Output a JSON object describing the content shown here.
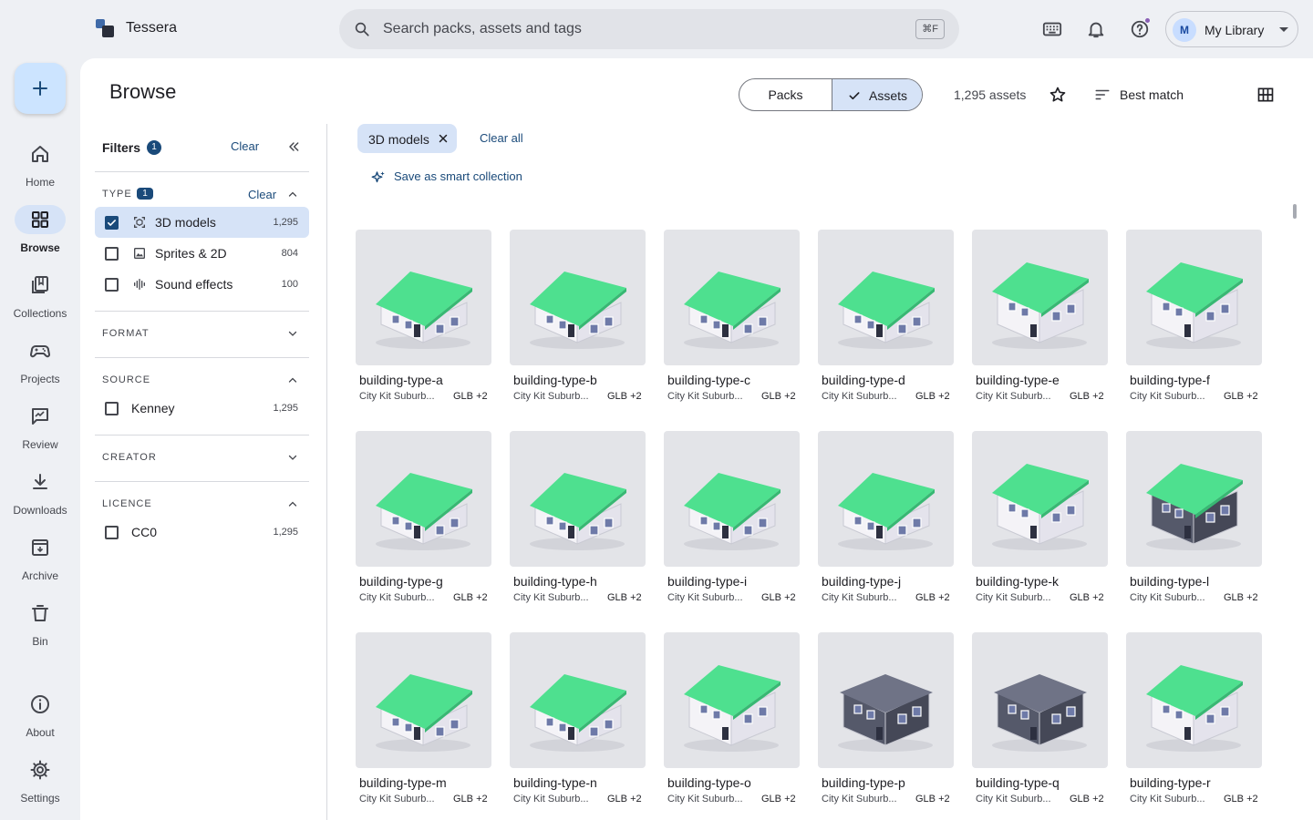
{
  "app": {
    "name": "Tessera"
  },
  "search": {
    "placeholder": "Search packs, assets and tags",
    "shortcut": "⌘F"
  },
  "topbar": {
    "icons": [
      "keyboard-icon",
      "bell-icon",
      "help-icon"
    ],
    "library_avatar": "M",
    "library_label": "My Library"
  },
  "rail": {
    "items": [
      {
        "label": "Home",
        "icon": "home-icon",
        "active": false
      },
      {
        "label": "Browse",
        "icon": "grid-icon",
        "active": true
      },
      {
        "label": "Collections",
        "icon": "collections-icon",
        "active": false
      },
      {
        "label": "Projects",
        "icon": "gamepad-icon",
        "active": false
      },
      {
        "label": "Review",
        "icon": "review-icon",
        "active": false
      },
      {
        "label": "Downloads",
        "icon": "download-icon",
        "active": false
      },
      {
        "label": "Archive",
        "icon": "archive-icon",
        "active": false
      },
      {
        "label": "Bin",
        "icon": "trash-icon",
        "active": false
      }
    ],
    "bottom": [
      {
        "label": "About",
        "icon": "info-icon"
      },
      {
        "label": "Settings",
        "icon": "gear-icon"
      }
    ]
  },
  "header": {
    "title": "Browse",
    "toggle": {
      "packs": "Packs",
      "assets": "Assets",
      "selected": "Assets"
    },
    "count": "1,295 assets",
    "sort": "Best match"
  },
  "filters": {
    "title": "Filters",
    "badge": "1",
    "clear": "Clear",
    "type": {
      "title": "TYPE",
      "badge": "1",
      "clear": "Clear",
      "expanded": true,
      "options": [
        {
          "label": "3D models",
          "count": "1,295",
          "checked": true,
          "icon": "model-3d-icon"
        },
        {
          "label": "Sprites & 2D",
          "count": "804",
          "checked": false,
          "icon": "image-icon"
        },
        {
          "label": "Sound effects",
          "count": "100",
          "checked": false,
          "icon": "audio-wave-icon"
        }
      ]
    },
    "format": {
      "title": "FORMAT",
      "expanded": false
    },
    "source": {
      "title": "SOURCE",
      "expanded": true,
      "options": [
        {
          "label": "Kenney",
          "count": "1,295",
          "checked": false
        }
      ]
    },
    "creator": {
      "title": "CREATOR",
      "expanded": false
    },
    "licence": {
      "title": "LICENCE",
      "expanded": true,
      "options": [
        {
          "label": "CC0",
          "count": "1,295",
          "checked": false
        }
      ]
    }
  },
  "active_filters": {
    "chips": [
      "3D models"
    ],
    "clear_all": "Clear all",
    "save": "Save as smart collection"
  },
  "colors": {
    "accent": "#1a4a7a",
    "selected_bg": "#d6e3f7",
    "roof": "#4ee08f",
    "wall": "#f4f3f7",
    "dark_wall": "#55596a"
  },
  "assets": [
    {
      "name": "building-type-a",
      "pack": "City Kit Suburb...",
      "formats": "GLB +2"
    },
    {
      "name": "building-type-b",
      "pack": "City Kit Suburb...",
      "formats": "GLB +2"
    },
    {
      "name": "building-type-c",
      "pack": "City Kit Suburb...",
      "formats": "GLB +2"
    },
    {
      "name": "building-type-d",
      "pack": "City Kit Suburb...",
      "formats": "GLB +2"
    },
    {
      "name": "building-type-e",
      "pack": "City Kit Suburb...",
      "formats": "GLB +2"
    },
    {
      "name": "building-type-f",
      "pack": "City Kit Suburb...",
      "formats": "GLB +2"
    },
    {
      "name": "building-type-g",
      "pack": "City Kit Suburb...",
      "formats": "GLB +2"
    },
    {
      "name": "building-type-h",
      "pack": "City Kit Suburb...",
      "formats": "GLB +2"
    },
    {
      "name": "building-type-i",
      "pack": "City Kit Suburb...",
      "formats": "GLB +2"
    },
    {
      "name": "building-type-j",
      "pack": "City Kit Suburb...",
      "formats": "GLB +2"
    },
    {
      "name": "building-type-k",
      "pack": "City Kit Suburb...",
      "formats": "GLB +2"
    },
    {
      "name": "building-type-l",
      "pack": "City Kit Suburb...",
      "formats": "GLB +2"
    },
    {
      "name": "building-type-m",
      "pack": "City Kit Suburb...",
      "formats": "GLB +2"
    },
    {
      "name": "building-type-n",
      "pack": "City Kit Suburb...",
      "formats": "GLB +2"
    },
    {
      "name": "building-type-o",
      "pack": "City Kit Suburb...",
      "formats": "GLB +2"
    },
    {
      "name": "building-type-p",
      "pack": "City Kit Suburb...",
      "formats": "GLB +2"
    },
    {
      "name": "building-type-q",
      "pack": "City Kit Suburb...",
      "formats": "GLB +2"
    },
    {
      "name": "building-type-r",
      "pack": "City Kit Suburb...",
      "formats": "GLB +2"
    }
  ]
}
